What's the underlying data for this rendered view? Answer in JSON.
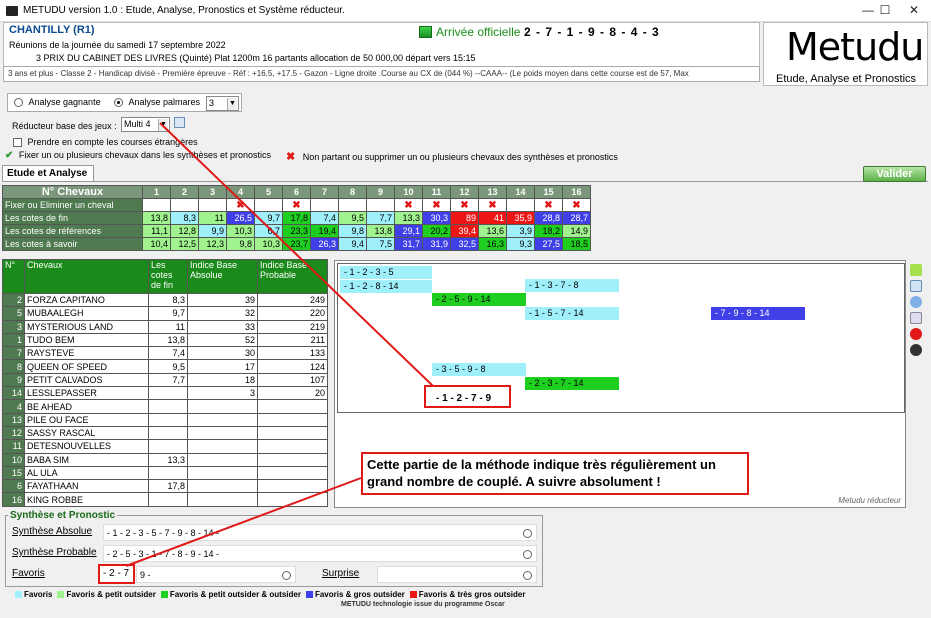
{
  "window": {
    "title": "METUDU version 1.0  : Etude, Analyse,  Pronostics et Système réducteur.",
    "min": "—",
    "max": "☐",
    "close": "✕"
  },
  "header": {
    "course": "CHANTILLY (R1)",
    "reunion": "Réunions de la journée du samedi 17 septembre 2022",
    "prix": "3 PRIX DU CABINET DES LIVRES (Quinté) Plat 1200m 16 partants allocation de 50 000,00 départ vers 15:15",
    "conditions": "3 ans et plus - Classe 2 - Handicap divisé - Première épreuve - Réf : +16.5, +17.5 - Gazon - Ligne droite .Course au CX de (044 %)  --CAAA--  (Le poids moyen dans cette course est de 57, Max",
    "arrivee_label": "Arrivée officielle :",
    "arrivee": "2 - 7 - 1 - 9 - 8 - 4 - 3"
  },
  "logo": {
    "title": "Metudu",
    "subtitle": "Etude, Analyse et Pronostics"
  },
  "options": {
    "analyse_gagnante": "Analyse gagnante",
    "analyse_palmares": "Analyse palmares",
    "palmares_value": "3",
    "reducteur_label": "Réducteur base des jeux :",
    "reducteur_value": "Multi 4",
    "etrangeres": "Prendre en compte les courses étrangères",
    "fixer": "Fixer un ou plusieurs chevaux dans les synthèses et pronostics",
    "non_partant": "Non partant ou supprimer un ou plusieurs chevaux des synthèses et pronostics"
  },
  "tab": {
    "label": "Etude et Analyse",
    "valider": "Valider"
  },
  "colors": {
    "cyan": "#9ff0fb",
    "lightgreen": "#9ff28e",
    "green": "#1fcf1f",
    "blue": "#4040e8",
    "red": "#ee1515"
  },
  "topgrid": {
    "header_label": "N° Chevaux",
    "numbers": [
      "1",
      "2",
      "3",
      "4",
      "5",
      "6",
      "7",
      "8",
      "9",
      "10",
      "11",
      "12",
      "13",
      "14",
      "15",
      "16"
    ],
    "fixer_label": "Fixer ou Eliminer un cheval",
    "fixer_marks": [
      "",
      "",
      "",
      "x",
      "",
      "x",
      "",
      "",
      "",
      "x",
      "x",
      "x",
      "x",
      "",
      "x",
      "x"
    ],
    "rows": [
      {
        "label": "Les cotes de fin",
        "values": [
          "13,8",
          "8,3",
          "11",
          "26,5",
          "9,7",
          "17,8",
          "7,4",
          "9,5",
          "7,7",
          "13,3",
          "30,3",
          "89",
          "41",
          "35,9",
          "28,8",
          "28,7"
        ],
        "colors": [
          "lg",
          "cyan",
          "lg",
          "b",
          "cyan",
          "g",
          "cyan",
          "lg",
          "cyan",
          "lg",
          "b",
          "r",
          "r",
          "r",
          "b",
          "b"
        ]
      },
      {
        "label": "Les cotes de références",
        "values": [
          "11,1",
          "12,8",
          "9,9",
          "10,3",
          "6,7",
          "23,3",
          "19,4",
          "9,8",
          "13,8",
          "29,1",
          "20,2",
          "39,4",
          "13,6",
          "3,9",
          "18,2",
          "14,9"
        ],
        "colors": [
          "lg",
          "lg",
          "cyan",
          "lg",
          "cyan",
          "g",
          "g",
          "cyan",
          "lg",
          "b",
          "g",
          "r",
          "lg",
          "cyan",
          "g",
          "lg"
        ]
      },
      {
        "label": "Les cotes à savoir",
        "values": [
          "10,4",
          "12,5",
          "12,3",
          "9,8",
          "10,3",
          "23,7",
          "26,3",
          "9,4",
          "7,5",
          "31,7",
          "31,9",
          "32,5",
          "16,3",
          "9,3",
          "27,5",
          "18,5"
        ],
        "colors": [
          "lg",
          "lg",
          "lg",
          "lg",
          "lg",
          "g",
          "b",
          "cyan",
          "cyan",
          "b",
          "b",
          "b",
          "g",
          "cyan",
          "b",
          "g"
        ]
      }
    ]
  },
  "grid2": {
    "headers": {
      "num": "N°",
      "chevaux": "Chevaux",
      "cotes": "Les cotes de fin",
      "iba": "Indice Base Absolue",
      "ibp": "Indice Base Probable"
    },
    "rows": [
      {
        "num": "2",
        "name": "FORZA CAPITANO",
        "cote": "8,3",
        "c": "cyan",
        "iba": "39",
        "ibp": "249"
      },
      {
        "num": "5",
        "name": "MUBAALEGH",
        "cote": "9,7",
        "c": "cyan",
        "iba": "32",
        "ibp": "220"
      },
      {
        "num": "3",
        "name": "MYSTERIOUS LAND",
        "cote": "11",
        "c": "lg",
        "iba": "33",
        "ibp": "219"
      },
      {
        "num": "1",
        "name": "TUDO BEM",
        "cote": "13,8",
        "c": "lg",
        "iba": "52",
        "ibp": "211"
      },
      {
        "num": "7",
        "name": "RAYSTEVE",
        "cote": "7,4",
        "c": "cyan",
        "iba": "30",
        "ibp": "133"
      },
      {
        "num": "8",
        "name": "QUEEN OF SPEED",
        "cote": "9,5",
        "c": "lg",
        "iba": "17",
        "ibp": "124"
      },
      {
        "num": "9",
        "name": "PETIT CALVADOS",
        "cote": "7,7",
        "c": "cyan",
        "iba": "18",
        "ibp": "107"
      },
      {
        "num": "14",
        "name": "LESSLEPASSER",
        "cote": "35,9",
        "c": "r",
        "iba": "3",
        "ibp": "20"
      },
      {
        "num": "4",
        "name": "BE AHEAD",
        "cote": "26,5",
        "c": "b",
        "iba": "",
        "ibp": ""
      },
      {
        "num": "13",
        "name": "PILE OU FACE",
        "cote": "41",
        "c": "r",
        "iba": "",
        "ibp": ""
      },
      {
        "num": "12",
        "name": "SASSY RASCAL",
        "cote": "89",
        "c": "r",
        "iba": "",
        "ibp": ""
      },
      {
        "num": "11",
        "name": "DETESNOUVELLES",
        "cote": "30,3",
        "c": "b",
        "iba": "",
        "ibp": ""
      },
      {
        "num": "10",
        "name": "BABA SIM",
        "cote": "13,3",
        "c": "lg",
        "iba": "",
        "ibp": ""
      },
      {
        "num": "15",
        "name": "AL ULA",
        "cote": "28,8",
        "c": "b",
        "iba": "",
        "ibp": ""
      },
      {
        "num": "6",
        "name": "FAYATHAAN",
        "cote": "17,8",
        "c": "g",
        "iba": "",
        "ibp": ""
      },
      {
        "num": "16",
        "name": "KING ROBBE",
        "cote": "28,7",
        "c": "b",
        "iba": "",
        "ibp": ""
      }
    ]
  },
  "reducteur": {
    "combos": [
      {
        "text": "- 1 - 2 - 3 - 5",
        "c": "cyan"
      },
      {
        "text": "- 1 - 2 - 8 - 14",
        "c": "cyan"
      },
      {
        "text": "- 2 - 5 - 9 - 14",
        "c": "g"
      },
      {
        "text": "- 1 - 3 - 7 - 8",
        "c": "cyan"
      },
      {
        "text": "- 1 - 5 - 7 - 14",
        "c": "cyan"
      },
      {
        "text": "- 7 - 9 - 8 - 14",
        "c": "b"
      },
      {
        "text": "- 3 - 5 - 9 - 8",
        "c": "cyan"
      },
      {
        "text": "- 2 - 3 - 7 - 14",
        "c": "g"
      },
      {
        "text": "- 1 - 2 - 7 - 9",
        "c": "cyan"
      }
    ],
    "footer": "Metudu réducteur"
  },
  "annotation": "Cette partie de la méthode indique très régulièrement un grand nombre de couplé. A suivre absolument !",
  "synthese": {
    "title": "Synthèse et Pronostic",
    "absolue_label": "Synthèse Absolue",
    "absolue": "- 1 - 2 - 3 - 5 - 7 - 9 - 8 - 14 -",
    "probable_label": "Synthèse Probable",
    "probable": "- 2 - 5 - 3 - 1 - 7 - 8 - 9 - 14 -",
    "favoris_label": "Favoris",
    "favoris": "- 2 - 7",
    "favoris_rest": "9 -",
    "surprise_label": "Surprise",
    "surprise": ""
  },
  "legend": {
    "items": [
      {
        "label": "Favoris",
        "c": "cyan"
      },
      {
        "label": "Favoris & petit outsider",
        "c": "lg"
      },
      {
        "label": "Favoris & petit outsider & outsider",
        "c": "g"
      },
      {
        "label": "Favoris & gros outsider",
        "c": "b"
      },
      {
        "label": "Favoris & très gros outsider",
        "c": "r"
      }
    ],
    "credit": "METUDU technologie issue du programme Oscar"
  }
}
